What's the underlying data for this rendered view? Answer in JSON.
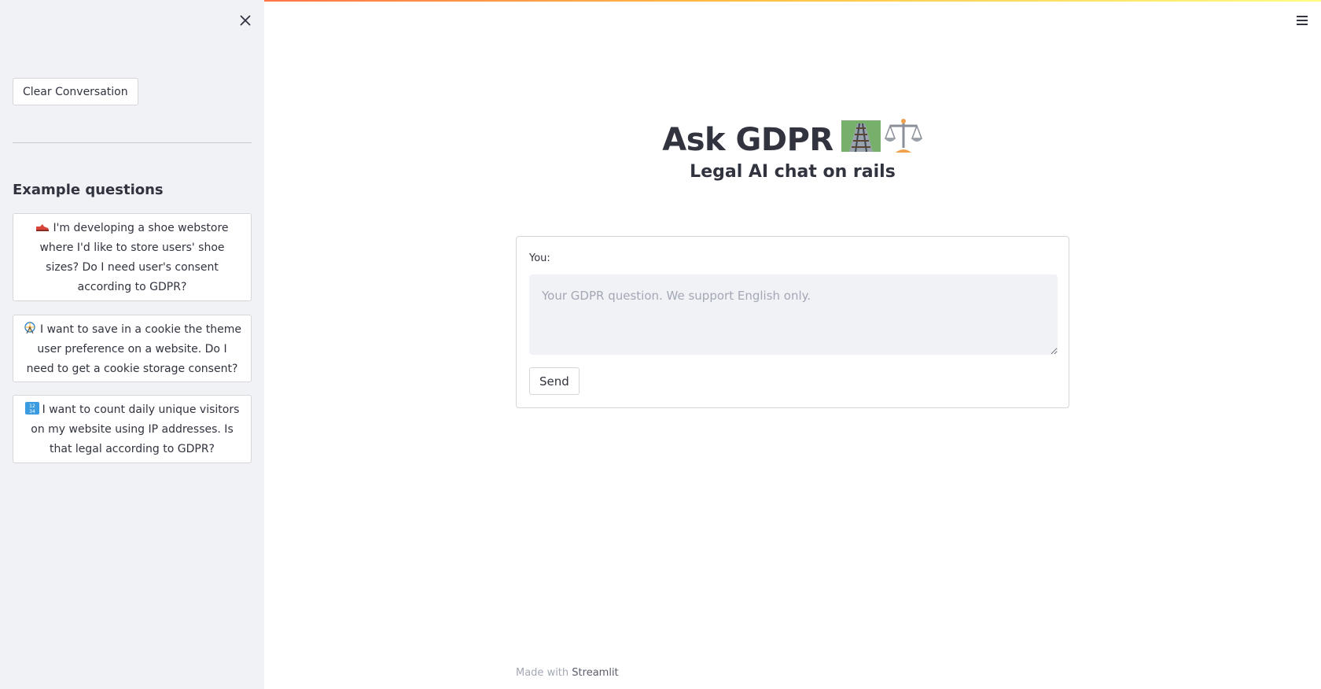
{
  "sidebar": {
    "clear_button": "Clear Conversation",
    "heading": "Example questions",
    "examples": [
      {
        "icon": "shoe-icon",
        "text": "I'm developing a shoe webstore where I'd like to store users' shoe sizes? Do I need user's consent according to GDPR?"
      },
      {
        "icon": "ferris-wheel-icon",
        "text": "I want to save in a cookie the theme user preference on a website. Do I need to get a cookie storage consent?"
      },
      {
        "icon": "numbers-icon",
        "text": "I want to count daily unique visitors on my website using IP addresses. Is that legal according to GDPR?"
      }
    ]
  },
  "main": {
    "title": "Ask GDPR",
    "title_icons": [
      "railway-track-icon",
      "balance-scale-icon"
    ],
    "subtitle": "Legal AI chat on rails",
    "form": {
      "label": "You:",
      "placeholder": "Your GDPR question. We support English only.",
      "value": "",
      "send_button": "Send"
    }
  },
  "footer": {
    "prefix": "Made with",
    "link": "Streamlit"
  },
  "colors": {
    "sidebar_bg": "#f0f2f6",
    "text": "#31333f",
    "gradient_start": "#ff4b4b",
    "gradient_end": "#fffd80"
  }
}
